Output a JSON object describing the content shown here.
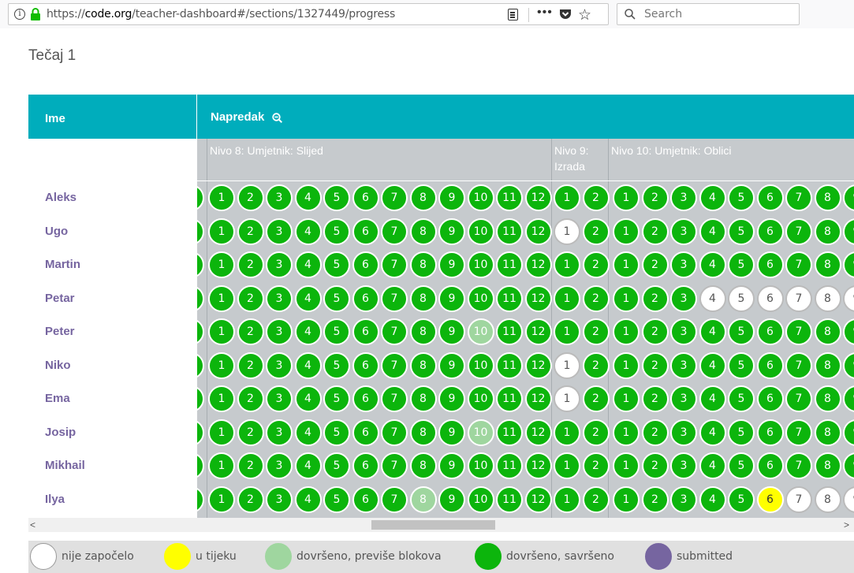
{
  "browser": {
    "url_prefix": "https://",
    "url_domain": "code.org",
    "url_path": "/teacher-dashboard#/sections/1327449/progress",
    "search_placeholder": "Search",
    "more_label": "•••"
  },
  "section_title": "Tečaj 1",
  "table": {
    "name_header": "Ime",
    "progress_header": "Napredak",
    "levels": [
      {
        "label": "Nivo 8: Umjetnik: Slijed"
      },
      {
        "label": "Nivo 9: Izrada"
      },
      {
        "label": "Nivo 10: Umjetnik: Oblici"
      }
    ],
    "students": [
      {
        "name": "Aleks",
        "l8": "GGGGGGGGGGGG",
        "l9": "GG",
        "l10": "GGGGGGGGG"
      },
      {
        "name": "Ugo",
        "l8": "GGGGGGGGGGGG",
        "l9": "WG",
        "l10": "GGGGGGGGG"
      },
      {
        "name": "Martin",
        "l8": "GGGGGGGGGGGG",
        "l9": "GG",
        "l10": "GGGGGGGGG"
      },
      {
        "name": "Petar",
        "l8": "GGGGGGGGGGGG",
        "l9": "GG",
        "l10": "GGGWWWWWW"
      },
      {
        "name": "Peter",
        "l8": "GGGGGGGGGLGG",
        "l9": "GG",
        "l10": "GGGGGGGGG"
      },
      {
        "name": "Niko",
        "l8": "GGGGGGGGGGGG",
        "l9": "WG",
        "l10": "GGGGGGGGG"
      },
      {
        "name": "Ema",
        "l8": "GGGGGGGGGGGG",
        "l9": "WG",
        "l10": "GGGGGGGGG"
      },
      {
        "name": "Josip",
        "l8": "GGGGGGGGGLGG",
        "l9": "GG",
        "l10": "GGGGGGGGG"
      },
      {
        "name": "Mikhail",
        "l8": "GGGGGGGGGGGG",
        "l9": "GG",
        "l10": "GGGGGGGGG"
      },
      {
        "name": "Ilya",
        "l8": "GGGGGGGLGGGG",
        "l9": "GG",
        "l10": "GGGGGYWWW"
      }
    ]
  },
  "scrollbar": {
    "left": "<",
    "right": ">"
  },
  "legend": [
    {
      "label": "nije započelo",
      "color": "#ffffff"
    },
    {
      "label": "u tijeku",
      "color": "#ffff00"
    },
    {
      "label": "dovršeno, previše blokova",
      "color": "#9fd69f"
    },
    {
      "label": "dovršeno, savršeno",
      "color": "#0cb50c"
    },
    {
      "label": "submitted",
      "color": "#7665a0"
    }
  ],
  "colors": {
    "header": "#00adbc",
    "name_text": "#7665a0",
    "perfect": "#0cb50c",
    "too_many_blocks": "#9fd69f",
    "in_progress": "#ffff00",
    "not_started": "#ffffff"
  }
}
